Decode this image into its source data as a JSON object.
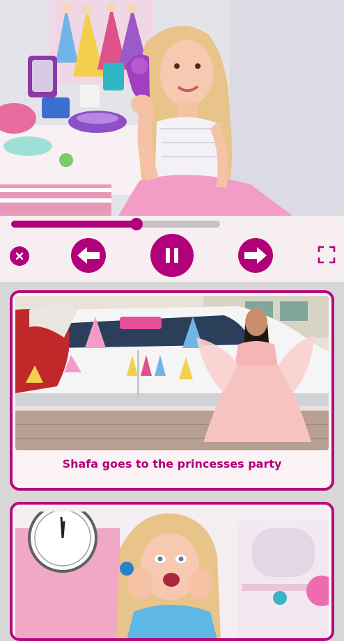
{
  "player": {
    "progress": 0.6,
    "colors": {
      "accent": "#b1007a",
      "panel": "#f6eef1"
    },
    "controls": {
      "close": "close-icon",
      "previous": "arrow-left-icon",
      "pause": "pause-icon",
      "next": "arrow-right-icon",
      "fullscreen": "fullscreen-icon"
    }
  },
  "playlist": {
    "items": [
      {
        "title": "Shafa goes to the princesses party"
      },
      {
        "title": ""
      }
    ]
  }
}
